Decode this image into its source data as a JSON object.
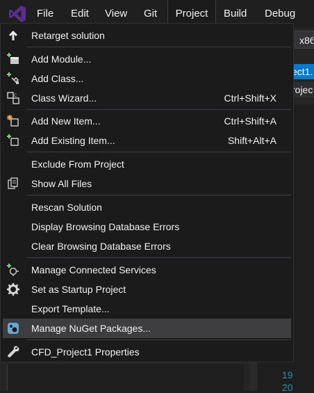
{
  "menubar": {
    "logo": "visual-studio-logo",
    "items": [
      "File",
      "Edit",
      "View",
      "Git",
      "Project",
      "Build",
      "Debug"
    ]
  },
  "side": {
    "platform": "x86",
    "tab_active": "ect1.",
    "tab_inactive": "rojec",
    "line_numbers": [
      "19",
      "20"
    ]
  },
  "dropdown": {
    "items": [
      {
        "label": "Retarget solution",
        "shortcut": "",
        "icon": "up-arrow-icon"
      },
      {
        "label": "Add Module...",
        "shortcut": "",
        "icon": "add-module-icon"
      },
      {
        "label": "Add Class...",
        "shortcut": "",
        "icon": "add-class-icon"
      },
      {
        "label": "Class Wizard...",
        "shortcut": "Ctrl+Shift+X",
        "icon": "class-wizard-icon"
      },
      {
        "label": "Add New Item...",
        "shortcut": "Ctrl+Shift+A",
        "icon": "add-new-item-icon"
      },
      {
        "label": "Add Existing Item...",
        "shortcut": "Shift+Alt+A",
        "icon": "add-existing-item-icon"
      },
      {
        "label": "Exclude From Project",
        "shortcut": "",
        "icon": ""
      },
      {
        "label": "Show All Files",
        "shortcut": "",
        "icon": "show-all-files-icon"
      },
      {
        "label": "Rescan Solution",
        "shortcut": "",
        "icon": ""
      },
      {
        "label": "Display Browsing Database Errors",
        "shortcut": "",
        "icon": ""
      },
      {
        "label": "Clear Browsing Database Errors",
        "shortcut": "",
        "icon": ""
      },
      {
        "label": "Manage Connected Services",
        "shortcut": "",
        "icon": "connected-services-icon"
      },
      {
        "label": "Set as Startup Project",
        "shortcut": "",
        "icon": "gear-icon"
      },
      {
        "label": "Export Template...",
        "shortcut": "",
        "icon": ""
      },
      {
        "label": "Manage NuGet Packages...",
        "shortcut": "",
        "icon": "nuget-icon"
      },
      {
        "label": "CFD_Project1 Properties",
        "shortcut": "",
        "icon": "wrench-icon"
      }
    ]
  },
  "colors": {
    "menu_bg": "#1b1b1c",
    "hover_bg": "#3e3e40",
    "accent": "#007acc",
    "logo": "#5c2d91"
  }
}
